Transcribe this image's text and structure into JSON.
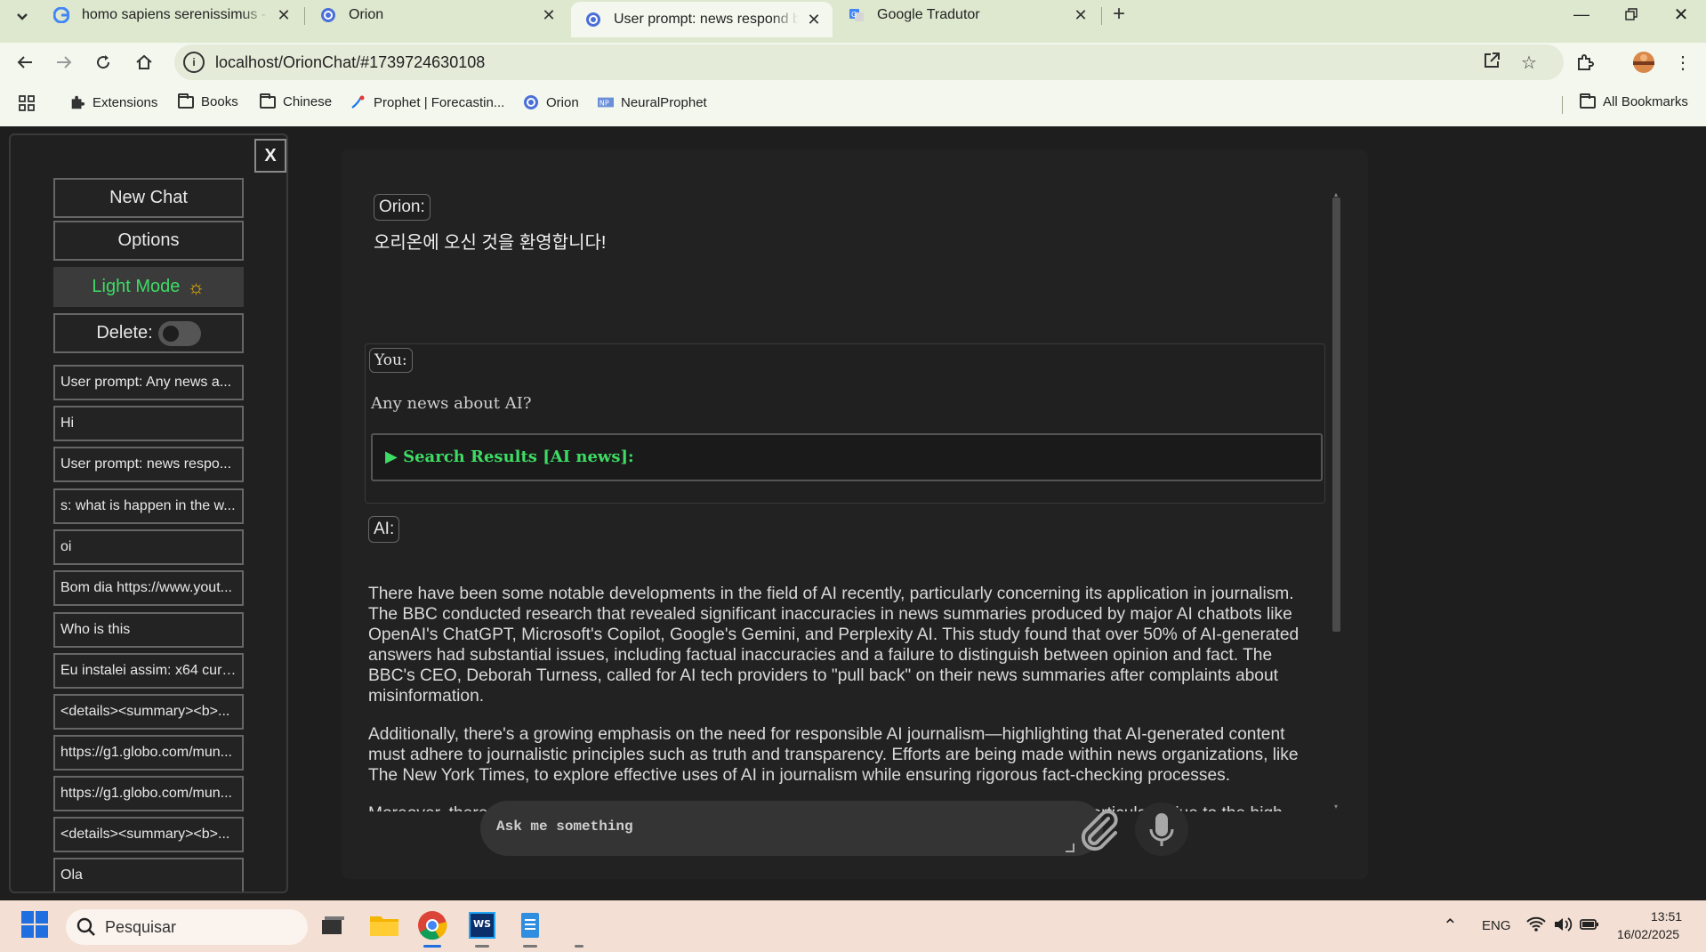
{
  "browser": {
    "tabs": [
      {
        "title": "homo sapiens serenissimus - Pe",
        "active": false
      },
      {
        "title": "Orion",
        "active": false
      },
      {
        "title": "User prompt: news respond ba",
        "active": true
      },
      {
        "title": "Google Tradutor",
        "active": false
      }
    ],
    "url": "localhost/OrionChat/#1739724630108",
    "bookmarks": [
      "Extensions",
      "Books",
      "Chinese",
      "Prophet | Forecastin...",
      "Orion",
      "NeuralProphet"
    ],
    "all_bookmarks": "All Bookmarks"
  },
  "sidebar": {
    "close_label": "X",
    "new_chat": "New Chat",
    "options": "Options",
    "light_mode": "Light Mode",
    "delete_label": "Delete:",
    "chats": [
      "User prompt: Any news a...",
      "Hi",
      "User prompt: news respo...",
      "s: what is happen in the w...",
      "oi",
      "Bom dia https://www.yout...",
      "Who is this",
      "Eu instalei assim: x64 curl...",
      "<details><summary><b>...",
      "https://g1.globo.com/mun...",
      "https://g1.globo.com/mun...",
      "<details><summary><b>...",
      "Ola"
    ]
  },
  "chat": {
    "orion_label": "Orion:",
    "welcome": "오리온에 오신 것을 환영합니다!",
    "you_label": "You:",
    "user_question": "Any news about AI?",
    "search_summary": "▶ Search Results [AI news]:",
    "ai_label": "AI:",
    "ai_paragraphs": [
      "There have been some notable developments in the field of AI recently, particularly concerning its application in journalism. The BBC conducted research that revealed significant inaccuracies in news summaries produced by major AI chatbots like OpenAI's ChatGPT, Microsoft's Copilot, Google's Gemini, and Perplexity AI. This study found that over 50% of AI-generated answers had substantial issues, including factual inaccuracies and a failure to distinguish between opinion and fact. The BBC's CEO, Deborah Turness, called for AI tech providers to \"pull back\" on their news summaries after complaints about misinformation.",
      "Additionally, there's a growing emphasis on the need for responsible AI journalism—highlighting that AI-generated content must adhere to journalistic principles such as truth and transparency. Efforts are being made within news organizations, like The New York Times, to explore effective uses of AI in journalism while ensuring rigorous fact-checking processes.",
      "Moreover, there are concerns regarding the environmental impact of generative AI technology, particularly due to the high"
    ],
    "input_placeholder": "Ask me something"
  },
  "taskbar": {
    "search_placeholder": "Pesquisar",
    "language": "ENG",
    "time": "13:51",
    "date": "16/02/2025"
  },
  "colors": {
    "accent_green": "#3ddc64",
    "sun": "#f2b705",
    "chrome_bg": "#dde8cf"
  }
}
